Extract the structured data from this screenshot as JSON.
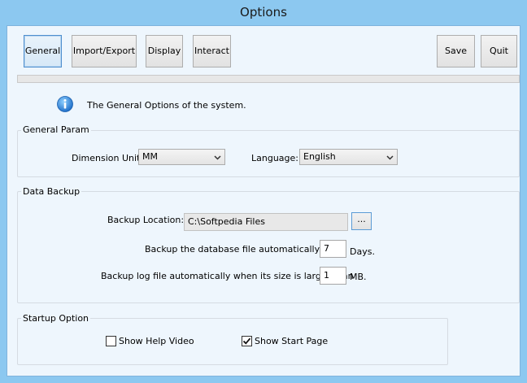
{
  "window": {
    "title": "Options"
  },
  "toolbar": {
    "general": "General",
    "import_export": "Import/Export",
    "display": "Display",
    "interact": "Interact",
    "save": "Save",
    "quit": "Quit"
  },
  "progress": {
    "value": 0
  },
  "info": {
    "text": "The General Options of the system.",
    "icon": "info-icon"
  },
  "general_param": {
    "title": "General Param",
    "dimension_label": "Dimension Unit:",
    "dimension_value": "MM",
    "language_label": "Language:",
    "language_value": "English"
  },
  "data_backup": {
    "title": "Data Backup",
    "location_label": "Backup Location:",
    "location_value": "C:\\Softpedia Files",
    "browse_label": "...",
    "auto_backup_label": "Backup the database file automatically after",
    "auto_backup_value": "7",
    "auto_backup_unit": "Days.",
    "log_backup_label": "Backup log file automatically when its size is larger than",
    "log_backup_value": "1",
    "log_backup_unit": "MB."
  },
  "startup": {
    "title": "Startup Option",
    "help_video_label": "Show Help Video",
    "help_video_checked": false,
    "start_page_label": "Show Start Page",
    "start_page_checked": true
  },
  "colors": {
    "titlebar": "#8cc8f0",
    "client": "#eef6fd",
    "accent": "#4f8fce"
  }
}
